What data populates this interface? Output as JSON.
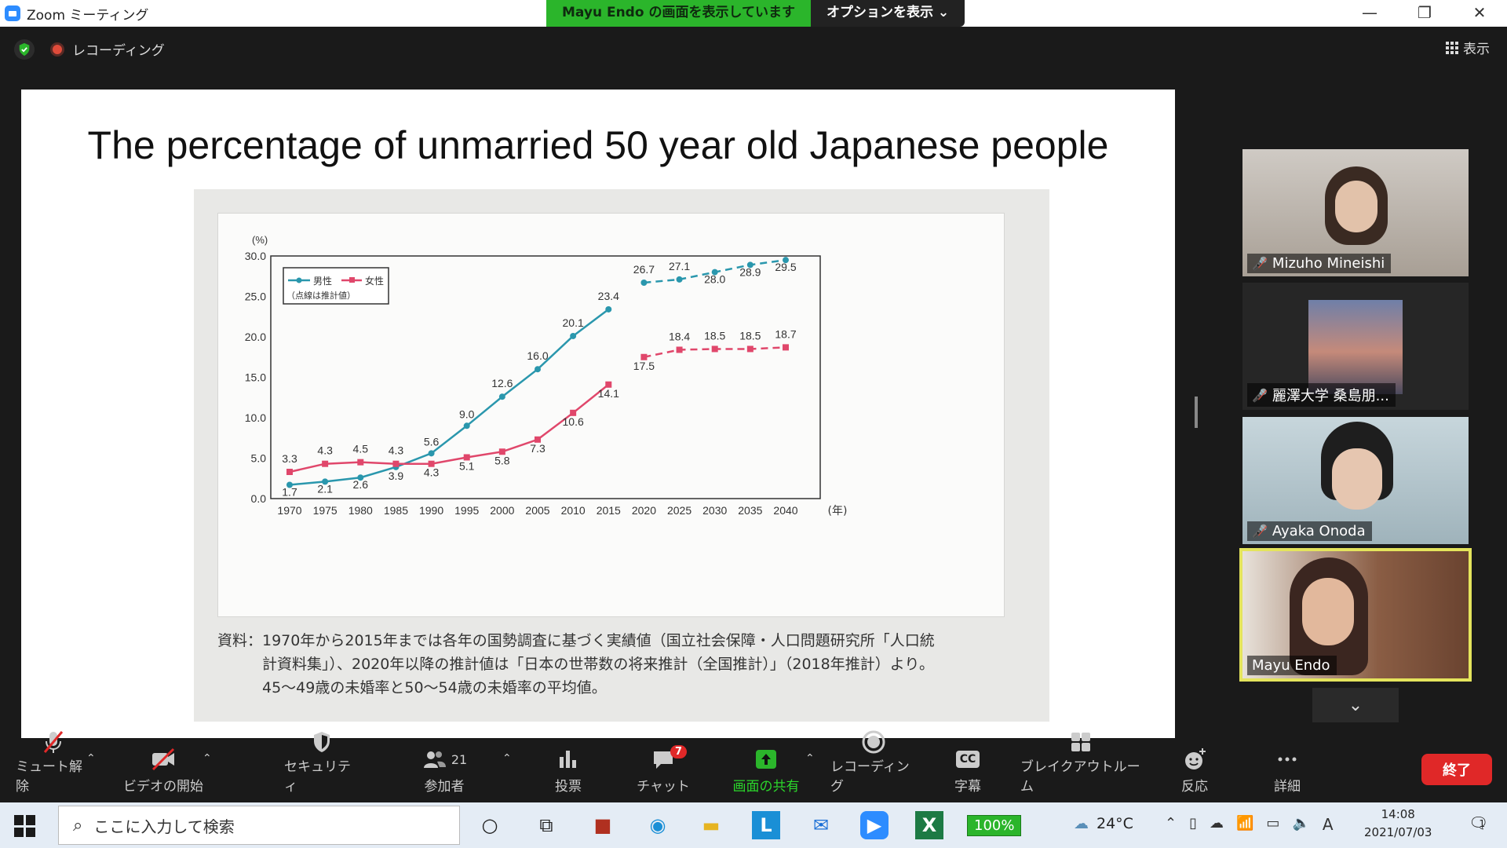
{
  "window": {
    "app_title": "Zoom ミーティング",
    "share_banner": "Mayu Endo の画面を表示しています",
    "options_label": "オプションを表示 ⌄",
    "controls": [
      "—",
      "❐",
      "✕"
    ]
  },
  "status": {
    "recording_label": "レコーディング",
    "view_label": "表示"
  },
  "slide": {
    "title": "The percentage of unmarried 50 year old Japanese people",
    "source_lines": [
      "資料：1970年から2015年までは各年の国勢調査に基づく実績値（国立社会保障・人口問題研究所「人口統",
      "　　　計資料集」）、2020年以降の推計値は「日本の世帯数の将来推計（全国推計）」（2018年推計）より。",
      "　　　45〜49歳の未婚率と50〜54歳の未婚率の平均値。"
    ]
  },
  "chart_data": {
    "type": "line",
    "ylabel": "(%)",
    "ylim": [
      0,
      30
    ],
    "yticks": [
      "0.0",
      "5.0",
      "10.0",
      "15.0",
      "20.0",
      "25.0",
      "30.0"
    ],
    "x_unit": "(年)",
    "x": [
      1970,
      1975,
      1980,
      1985,
      1990,
      1995,
      2000,
      2005,
      2010,
      2015,
      2020,
      2025,
      2030,
      2035,
      2040
    ],
    "legend": {
      "male": "男性",
      "female": "女性",
      "note": "（点線は推計値）"
    },
    "series": [
      {
        "name": "男性",
        "color": "#2a97ad",
        "actual": [
          1.7,
          2.1,
          2.6,
          3.9,
          5.6,
          9.0,
          12.6,
          16.0,
          20.1,
          23.4
        ],
        "actual_labels": [
          "1.7",
          "2.1",
          "2.6",
          "3.9",
          "5.6",
          "9.0",
          "12.6",
          "16.0",
          "20.1",
          "23.4"
        ],
        "projected": [
          26.7,
          27.1,
          28.0,
          28.9,
          29.5
        ],
        "projected_labels": [
          "26.7",
          "27.1",
          "28.0",
          "28.9",
          "29.5"
        ]
      },
      {
        "name": "女性",
        "color": "#e0476b",
        "actual": [
          3.3,
          4.3,
          4.5,
          4.3,
          4.3,
          5.1,
          5.8,
          7.3,
          10.6,
          14.1
        ],
        "actual_labels": [
          "3.3",
          "4.3",
          "4.5",
          "4.3",
          "4.3",
          "5.1",
          "5.8",
          "7.3",
          "10.6",
          "14.1"
        ],
        "projected": [
          17.5,
          18.4,
          18.5,
          18.5,
          18.7
        ],
        "projected_labels": [
          "17.5",
          "18.4",
          "18.5",
          "18.5",
          "18.7"
        ]
      }
    ]
  },
  "participants": [
    {
      "name": "Mizuho Mineishi",
      "muted": true,
      "bg": "#b9b4ae"
    },
    {
      "name": "麗澤大学 桑島朋...",
      "muted": true,
      "bg": "#222"
    },
    {
      "name": "Ayaka Onoda",
      "muted": true,
      "bg": "#a5b8c0"
    },
    {
      "name": "Mayu Endo",
      "muted": false,
      "bg": "#7a5a48"
    }
  ],
  "toolbar": {
    "mute": "ミュート解除",
    "video": "ビデオの開始",
    "security": "セキュリティ",
    "participants": "参加者",
    "participants_count": "21",
    "polls": "投票",
    "chat": "チャット",
    "chat_badge": "7",
    "share": "画面の共有",
    "record": "レコーディング",
    "captions": "字幕",
    "captions_icon": "CC",
    "breakout": "ブレイクアウトルーム",
    "reactions": "反応",
    "more": "詳細",
    "end": "終了"
  },
  "taskbar": {
    "search_placeholder": "ここに入力して検索",
    "battery_app": "100%",
    "temperature": "24°C",
    "ime": "A",
    "time": "14:08",
    "date": "2021/07/03",
    "notification_count": "1"
  }
}
